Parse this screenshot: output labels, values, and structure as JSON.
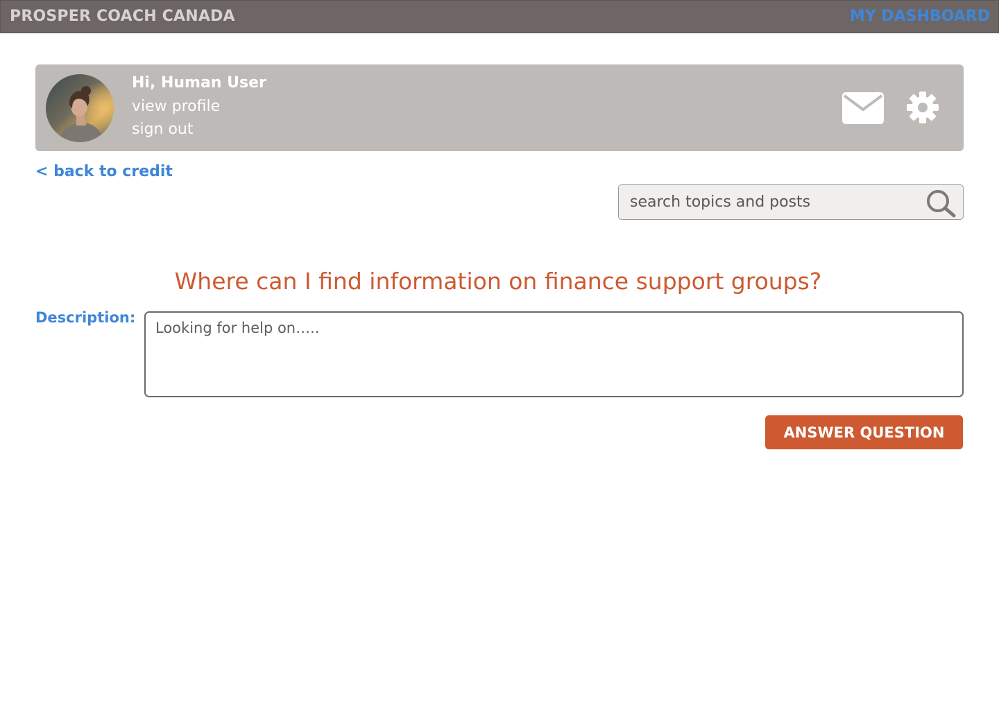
{
  "header": {
    "brand": "PROSPER COACH CANADA",
    "dashboard_label": "MY DASHBOARD"
  },
  "profile": {
    "greeting": "Hi, Human User",
    "view_profile_label": "view profile",
    "sign_out_label": "sign out",
    "avatar_icon": "user-avatar-photo",
    "mail_icon": "mail-icon",
    "settings_icon": "gear-icon"
  },
  "nav": {
    "back_label": "< back to credit"
  },
  "search": {
    "placeholder": "search topics and posts",
    "icon": "search-icon"
  },
  "question": {
    "title": "Where can I find information on finance support groups?",
    "description_label": "Description:",
    "description_placeholder": "Looking for help on….."
  },
  "actions": {
    "answer_label": "ANSWER QUESTION"
  },
  "colors": {
    "header_bg": "#6e6664",
    "brand_text": "#d7d3d1",
    "link_blue": "#3f86d8",
    "profile_card_bg": "#bdbab7",
    "accent_orange": "#cd5a31",
    "search_bg": "#f1efed"
  }
}
